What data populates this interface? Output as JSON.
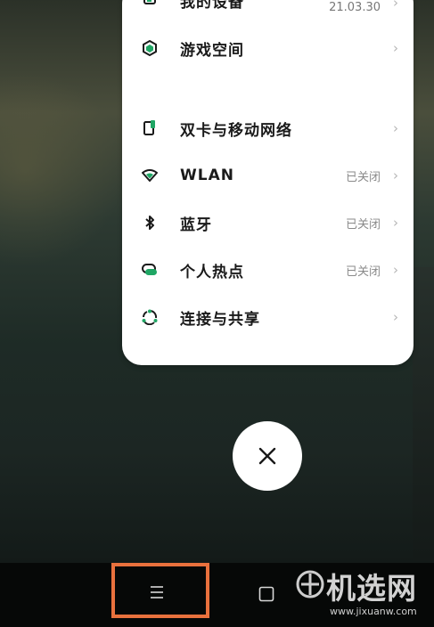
{
  "settings": {
    "items": [
      {
        "label": "我的设备",
        "date": "21.03.30",
        "icon": "device-icon"
      },
      {
        "label": "游戏空间",
        "icon": "game-space-icon"
      },
      {
        "label": "双卡与移动网络",
        "icon": "sim-card-icon"
      },
      {
        "label": "WLAN",
        "status": "已关闭",
        "icon": "wifi-icon"
      },
      {
        "label": "蓝牙",
        "status": "已关闭",
        "icon": "bluetooth-icon"
      },
      {
        "label": "个人热点",
        "status": "已关闭",
        "icon": "hotspot-icon"
      },
      {
        "label": "连接与共享",
        "icon": "connection-share-icon"
      }
    ]
  },
  "watermark": {
    "logo_text": "机选网",
    "url": "www.jixuanw.com"
  },
  "icons": {
    "close": "close-icon",
    "menu": "menu-icon",
    "home": "home-icon",
    "chevron": "chevron-right-icon"
  },
  "colors": {
    "accent_green": "#1fa664",
    "highlight_orange": "#e9713d",
    "card_bg": "#ffffff"
  }
}
